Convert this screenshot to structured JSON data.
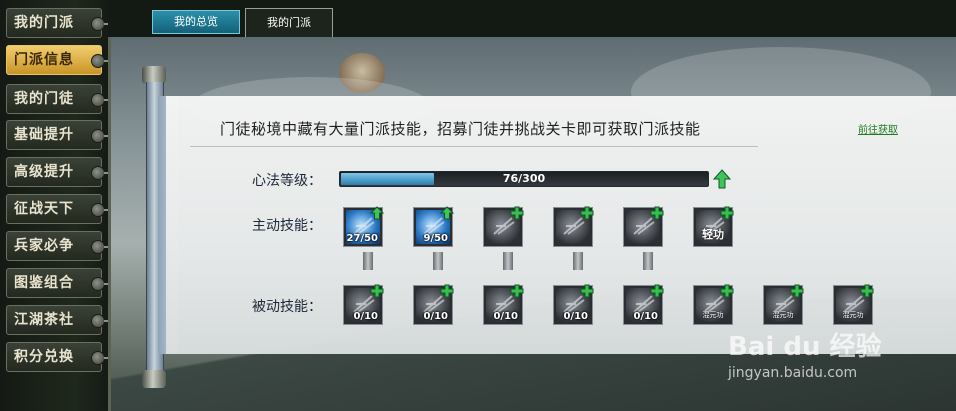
{
  "sidebar": {
    "items": [
      {
        "label": "我的门派"
      },
      {
        "label": "门派信息",
        "active": true
      },
      {
        "label": "我的门徒"
      },
      {
        "label": "基础提升"
      },
      {
        "label": "高级提升"
      },
      {
        "label": "征战天下"
      },
      {
        "label": "兵家必争"
      },
      {
        "label": "图鉴组合"
      },
      {
        "label": "江湖茶社"
      },
      {
        "label": "积分兑换"
      }
    ]
  },
  "tabs": {
    "overview": "我的总览",
    "my_sect": "我的门派"
  },
  "panel": {
    "headline": "门徒秘境中藏有大量门派技能，招募门徒并挑战关卡即可获取门派技能",
    "goto_link": "前往获取",
    "xinfa_label": "心法等级：",
    "xinfa_text": "76/300",
    "xinfa_value": 76,
    "xinfa_max": 300,
    "active_label": "主动技能：",
    "passive_label": "被动技能："
  },
  "active_skills": [
    {
      "count": "27/50",
      "badge": "up",
      "lit": true
    },
    {
      "count": "9/50",
      "badge": "up",
      "lit": true
    },
    {
      "count": "",
      "badge": "plus",
      "lit": false
    },
    {
      "count": "",
      "badge": "plus",
      "lit": false
    },
    {
      "count": "",
      "badge": "plus",
      "lit": false
    },
    {
      "name": "轻功",
      "badge": "plus",
      "lit": false
    }
  ],
  "passive_skills": [
    {
      "count": "0/10",
      "badge": "plus"
    },
    {
      "count": "0/10",
      "badge": "plus"
    },
    {
      "count": "0/10",
      "badge": "plus"
    },
    {
      "count": "0/10",
      "badge": "plus"
    },
    {
      "count": "0/10",
      "badge": "plus"
    },
    {
      "sub": "混元功",
      "badge": "plus"
    },
    {
      "sub": "混元功",
      "badge": "plus"
    },
    {
      "sub": "混元功",
      "badge": "plus"
    }
  ],
  "watermark": {
    "brand": "Bai du 经验",
    "url": "jingyan.baidu.com"
  },
  "colors": {
    "active_tab": "#1f7a96",
    "sidebar_active": "#d9a83a",
    "plus_green": "#2fb34a",
    "progress_fill": "#2a7fb0"
  }
}
